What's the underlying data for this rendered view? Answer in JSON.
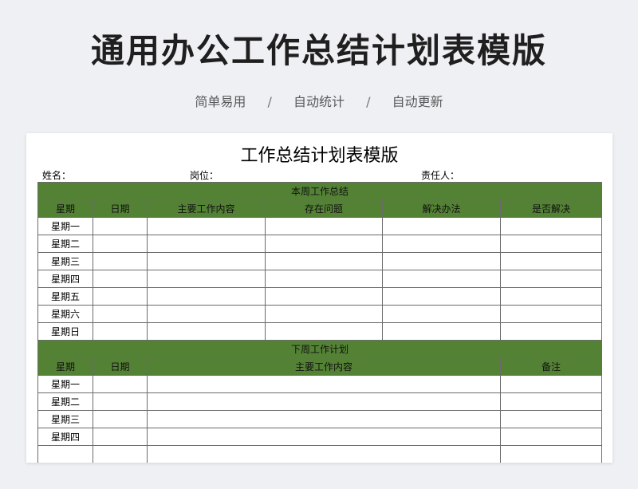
{
  "header": {
    "main_title": "通用办公工作总结计划表模版",
    "subtitle_parts": [
      "简单易用",
      "自动统计",
      "自动更新"
    ],
    "separator": "/"
  },
  "sheet": {
    "title": "工作总结计划表模版",
    "meta": {
      "name_label": "姓名：",
      "position_label": "岗位：",
      "responsible_label": "责任人："
    }
  },
  "summary_section": {
    "title": "本周工作总结",
    "columns": [
      "星期",
      "日期",
      "主要工作内容",
      "存在问题",
      "解决办法",
      "是否解决"
    ],
    "rows": [
      "星期一",
      "星期二",
      "星期三",
      "星期四",
      "星期五",
      "星期六",
      "星期日"
    ]
  },
  "plan_section": {
    "title": "下周工作计划",
    "columns": [
      "星期",
      "日期",
      "主要工作内容",
      "备注"
    ],
    "rows": [
      "星期一",
      "星期二",
      "星期三",
      "星期四",
      ""
    ]
  },
  "colors": {
    "header_green": "#548235",
    "background": "#eef0f3"
  }
}
